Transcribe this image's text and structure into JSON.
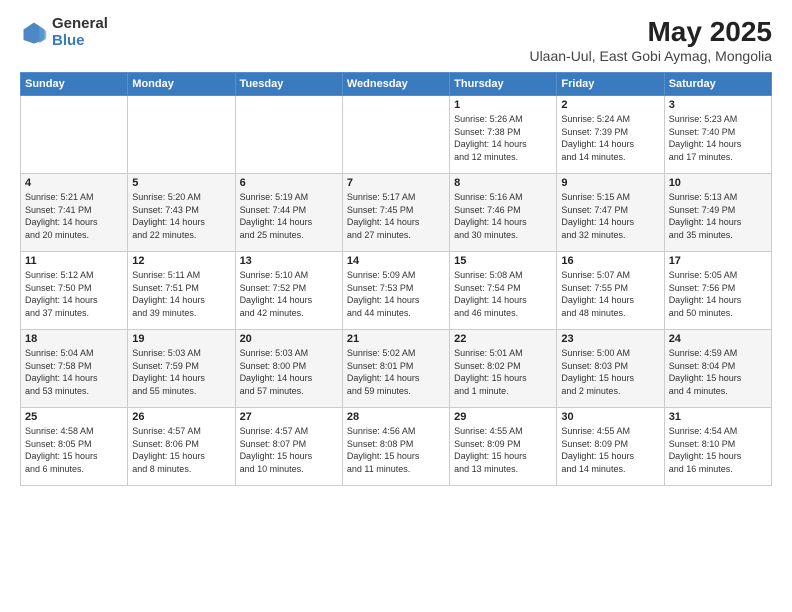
{
  "logo": {
    "general": "General",
    "blue": "Blue"
  },
  "header": {
    "title": "May 2025",
    "subtitle": "Ulaan-Uul, East Gobi Aymag, Mongolia"
  },
  "weekdays": [
    "Sunday",
    "Monday",
    "Tuesday",
    "Wednesday",
    "Thursday",
    "Friday",
    "Saturday"
  ],
  "weeks": [
    [
      {
        "day": "",
        "info": ""
      },
      {
        "day": "",
        "info": ""
      },
      {
        "day": "",
        "info": ""
      },
      {
        "day": "",
        "info": ""
      },
      {
        "day": "1",
        "info": "Sunrise: 5:26 AM\nSunset: 7:38 PM\nDaylight: 14 hours\nand 12 minutes."
      },
      {
        "day": "2",
        "info": "Sunrise: 5:24 AM\nSunset: 7:39 PM\nDaylight: 14 hours\nand 14 minutes."
      },
      {
        "day": "3",
        "info": "Sunrise: 5:23 AM\nSunset: 7:40 PM\nDaylight: 14 hours\nand 17 minutes."
      }
    ],
    [
      {
        "day": "4",
        "info": "Sunrise: 5:21 AM\nSunset: 7:41 PM\nDaylight: 14 hours\nand 20 minutes."
      },
      {
        "day": "5",
        "info": "Sunrise: 5:20 AM\nSunset: 7:43 PM\nDaylight: 14 hours\nand 22 minutes."
      },
      {
        "day": "6",
        "info": "Sunrise: 5:19 AM\nSunset: 7:44 PM\nDaylight: 14 hours\nand 25 minutes."
      },
      {
        "day": "7",
        "info": "Sunrise: 5:17 AM\nSunset: 7:45 PM\nDaylight: 14 hours\nand 27 minutes."
      },
      {
        "day": "8",
        "info": "Sunrise: 5:16 AM\nSunset: 7:46 PM\nDaylight: 14 hours\nand 30 minutes."
      },
      {
        "day": "9",
        "info": "Sunrise: 5:15 AM\nSunset: 7:47 PM\nDaylight: 14 hours\nand 32 minutes."
      },
      {
        "day": "10",
        "info": "Sunrise: 5:13 AM\nSunset: 7:49 PM\nDaylight: 14 hours\nand 35 minutes."
      }
    ],
    [
      {
        "day": "11",
        "info": "Sunrise: 5:12 AM\nSunset: 7:50 PM\nDaylight: 14 hours\nand 37 minutes."
      },
      {
        "day": "12",
        "info": "Sunrise: 5:11 AM\nSunset: 7:51 PM\nDaylight: 14 hours\nand 39 minutes."
      },
      {
        "day": "13",
        "info": "Sunrise: 5:10 AM\nSunset: 7:52 PM\nDaylight: 14 hours\nand 42 minutes."
      },
      {
        "day": "14",
        "info": "Sunrise: 5:09 AM\nSunset: 7:53 PM\nDaylight: 14 hours\nand 44 minutes."
      },
      {
        "day": "15",
        "info": "Sunrise: 5:08 AM\nSunset: 7:54 PM\nDaylight: 14 hours\nand 46 minutes."
      },
      {
        "day": "16",
        "info": "Sunrise: 5:07 AM\nSunset: 7:55 PM\nDaylight: 14 hours\nand 48 minutes."
      },
      {
        "day": "17",
        "info": "Sunrise: 5:05 AM\nSunset: 7:56 PM\nDaylight: 14 hours\nand 50 minutes."
      }
    ],
    [
      {
        "day": "18",
        "info": "Sunrise: 5:04 AM\nSunset: 7:58 PM\nDaylight: 14 hours\nand 53 minutes."
      },
      {
        "day": "19",
        "info": "Sunrise: 5:03 AM\nSunset: 7:59 PM\nDaylight: 14 hours\nand 55 minutes."
      },
      {
        "day": "20",
        "info": "Sunrise: 5:03 AM\nSunset: 8:00 PM\nDaylight: 14 hours\nand 57 minutes."
      },
      {
        "day": "21",
        "info": "Sunrise: 5:02 AM\nSunset: 8:01 PM\nDaylight: 14 hours\nand 59 minutes."
      },
      {
        "day": "22",
        "info": "Sunrise: 5:01 AM\nSunset: 8:02 PM\nDaylight: 15 hours\nand 1 minute."
      },
      {
        "day": "23",
        "info": "Sunrise: 5:00 AM\nSunset: 8:03 PM\nDaylight: 15 hours\nand 2 minutes."
      },
      {
        "day": "24",
        "info": "Sunrise: 4:59 AM\nSunset: 8:04 PM\nDaylight: 15 hours\nand 4 minutes."
      }
    ],
    [
      {
        "day": "25",
        "info": "Sunrise: 4:58 AM\nSunset: 8:05 PM\nDaylight: 15 hours\nand 6 minutes."
      },
      {
        "day": "26",
        "info": "Sunrise: 4:57 AM\nSunset: 8:06 PM\nDaylight: 15 hours\nand 8 minutes."
      },
      {
        "day": "27",
        "info": "Sunrise: 4:57 AM\nSunset: 8:07 PM\nDaylight: 15 hours\nand 10 minutes."
      },
      {
        "day": "28",
        "info": "Sunrise: 4:56 AM\nSunset: 8:08 PM\nDaylight: 15 hours\nand 11 minutes."
      },
      {
        "day": "29",
        "info": "Sunrise: 4:55 AM\nSunset: 8:09 PM\nDaylight: 15 hours\nand 13 minutes."
      },
      {
        "day": "30",
        "info": "Sunrise: 4:55 AM\nSunset: 8:09 PM\nDaylight: 15 hours\nand 14 minutes."
      },
      {
        "day": "31",
        "info": "Sunrise: 4:54 AM\nSunset: 8:10 PM\nDaylight: 15 hours\nand 16 minutes."
      }
    ]
  ]
}
